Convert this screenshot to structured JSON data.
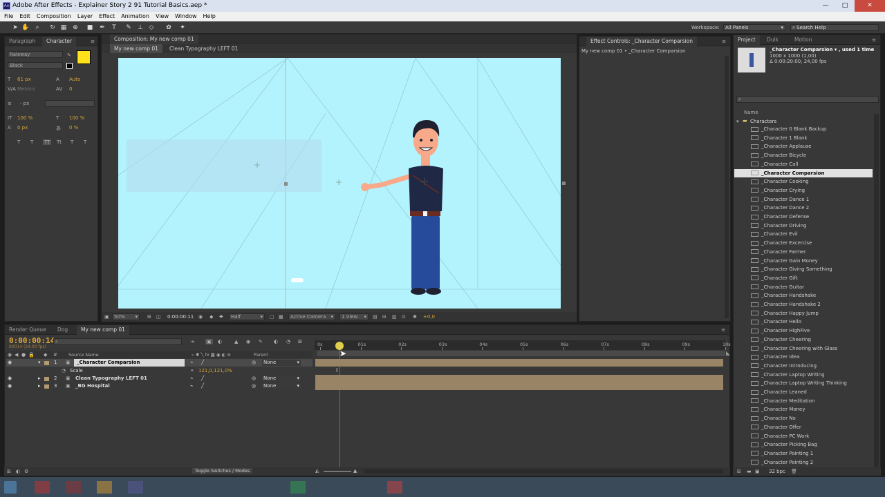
{
  "window": {
    "title": "Adobe After Effects - Explainer Story 2 91 Tutorial Basics.aep *",
    "minimize": "—",
    "maximize": "□",
    "close": "✕"
  },
  "menu": [
    "File",
    "Edit",
    "Composition",
    "Layer",
    "Effect",
    "Animation",
    "View",
    "Window",
    "Help"
  ],
  "toolbar": {
    "workspace_label": "Workspace:",
    "workspace_value": "All Panels",
    "search_help": "Search Help"
  },
  "character_panel": {
    "tabs": [
      "Paragraph",
      "Character"
    ],
    "font_family": "Raleway",
    "font_style": "Black",
    "font_size": "61 px",
    "leading": "Auto",
    "kerning": "Metrics",
    "tracking": "0",
    "stroke_width": "- px",
    "vert_scale": "100 %",
    "horiz_scale": "100 %",
    "baseline": "0 px",
    "tsume": "0 %",
    "fill_color": "#ffe21b",
    "style_buttons": [
      "T",
      "T",
      "TT",
      "Tt",
      "T",
      "T"
    ]
  },
  "composition": {
    "tab_label": "Composition: My new comp 01",
    "breadcrumbs": [
      "My new comp 01",
      "Clean Typography LEFT 01"
    ],
    "zoom": "50%",
    "timecode": "0:00:00:11",
    "resolution": "Half",
    "camera": "Active Camera",
    "views": "1 View",
    "exposure": "+0,0",
    "bg_color": "#b3f3fd"
  },
  "effect_controls": {
    "tab_label": "Effect Controls: _Character Comparsion",
    "subtitle": "My new comp 01 • _Character Comparsion"
  },
  "project": {
    "tabs": [
      "Project",
      "Dulk",
      "Motion"
    ],
    "item_name": "_Character Comparsion ▾ , used 1 time",
    "item_dims": "1000 x 1000 (1,00)",
    "item_duration": "Δ 0:00:20:00, 24,00 fps",
    "column_name": "Name",
    "folder": "Characters",
    "selected_index": 5,
    "items": [
      "_Character 0 Blank Backup",
      "_Character 1 Blank",
      "_Character Applause",
      "_Character Bicycle",
      "_Character Call",
      "_Character Comparsion",
      "_Character Cooking",
      "_Character Crying",
      "_Character Dance 1",
      "_Character Dance 2",
      "_Character Defense",
      "_Character Driving",
      "_Character Evil",
      "_Character Excercise",
      "_Character Farmer",
      "_Character Gain Money",
      "_Character Giving Something",
      "_Character Gift",
      "_Character Guitar",
      "_Character Handshake",
      "_Character Handshake 2",
      "_Character Happy Jump",
      "_Character Hello",
      "_Character HighFive",
      "_Character Cheering",
      "_Character Cheering with Glass",
      "_Character Idea",
      "_Character Introducing",
      "_Character Laptop Writing",
      "_Character Laptop Writing Thinking",
      "_Character Leaned",
      "_Character Meditation",
      "_Character Money",
      "_Character No",
      "_Character Offer",
      "_Character PC Work",
      "_Character Picking Bag",
      "_Character Pointing 1",
      "_Character Pointing 2"
    ],
    "bpc": "32 bpc"
  },
  "timeline": {
    "tabs": [
      "Render Queue",
      "Dog",
      "My new comp 01"
    ],
    "timecode": "0:00:00:14",
    "timecode_sub": "00014 (24.00 fps)",
    "col_source": "Source Name",
    "col_parent": "Parent",
    "ruler": [
      "0s",
      "01s",
      "02s",
      "03s",
      "04s",
      "05s",
      "06s",
      "07s",
      "08s",
      "09s",
      "10s"
    ],
    "layers": [
      {
        "num": "1",
        "name": "_Character Comparsion",
        "parent": "None"
      },
      {
        "num": "2",
        "name": "Clean Typography LEFT 01",
        "parent": "None"
      },
      {
        "num": "3",
        "name": "_BG Hospital",
        "parent": "None"
      }
    ],
    "scale_label": "Scale",
    "scale_value": "121,0,121,0%",
    "toggle": "Toggle Switches / Modes"
  }
}
